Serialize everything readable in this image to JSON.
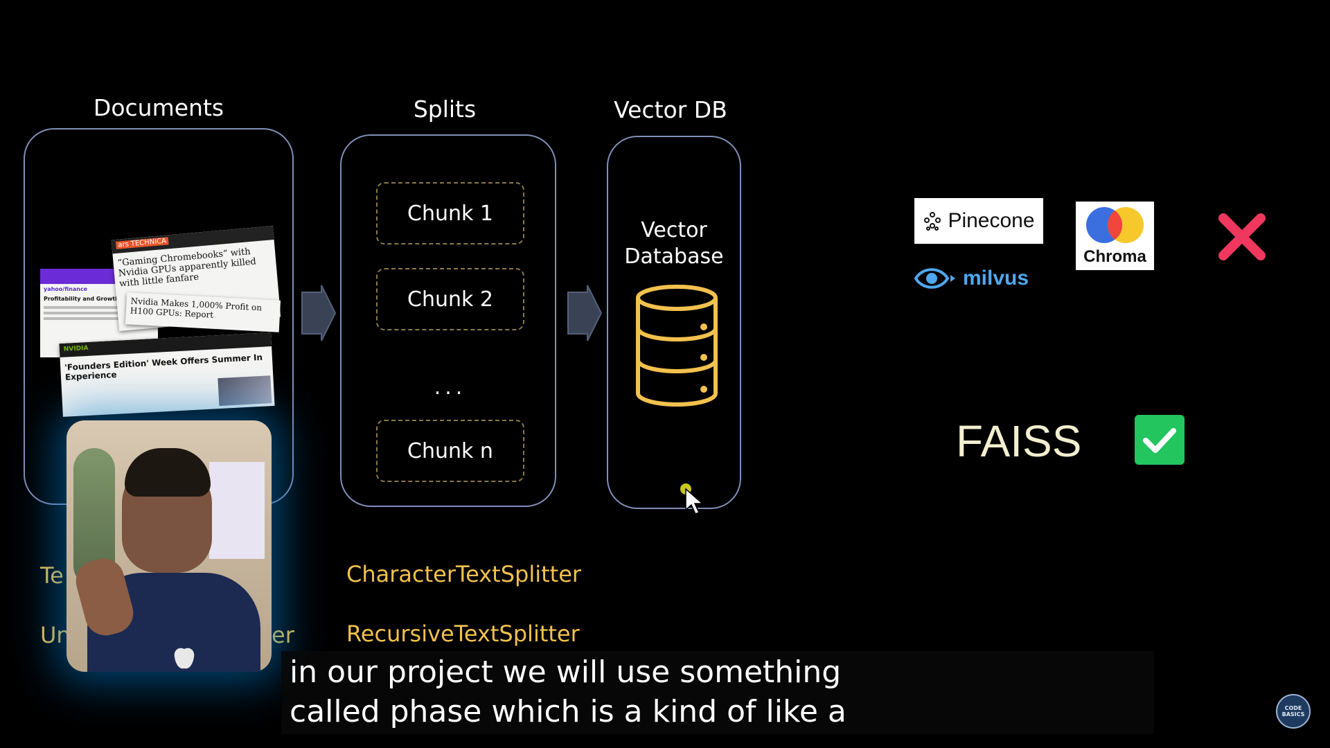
{
  "headings": {
    "documents": "Documents",
    "splits": "Splits",
    "vectordb": "Vector DB"
  },
  "chunks": [
    "Chunk 1",
    "Chunk 2",
    "...",
    "Chunk n"
  ],
  "vectordb": {
    "label_line1": "Vector",
    "label_line2": "Database",
    "icon": "database-icon"
  },
  "articles": {
    "a1_brand": "ars TECHNICA",
    "a1_headline": "“Gaming Chromebooks” with Nvidia GPUs apparently killed with little fanfare",
    "a1_sub": "Nvidia Makes 1,000% Profit on H100 GPUs: Report",
    "a2_brand": "yahoo/finance",
    "a2_section": "Profitability and Growth",
    "a3_brand": "NVIDIA",
    "a3_headline": "'Founders Edition' Week Offers Summer In Experience"
  },
  "loaders": {
    "line1": "Te",
    "line2": "Un",
    "line2_tail": "er"
  },
  "splitters": [
    "CharacterTextSplitter",
    "RecursiveTextSplitter"
  ],
  "vector_stores": {
    "pinecone": "Pinecone",
    "chroma": "Chroma",
    "milvus": "milvus",
    "faiss": "FAISS"
  },
  "caption": {
    "line1": "in our project we will use something",
    "line2": "called phase which is a kind of like a"
  },
  "channel_logo": "CODE BASICS",
  "colors": {
    "accent_yellow": "#f2c14e",
    "reject_red": "#f0385f",
    "accept_green": "#22c55e",
    "panel_border": "#8090b8"
  }
}
